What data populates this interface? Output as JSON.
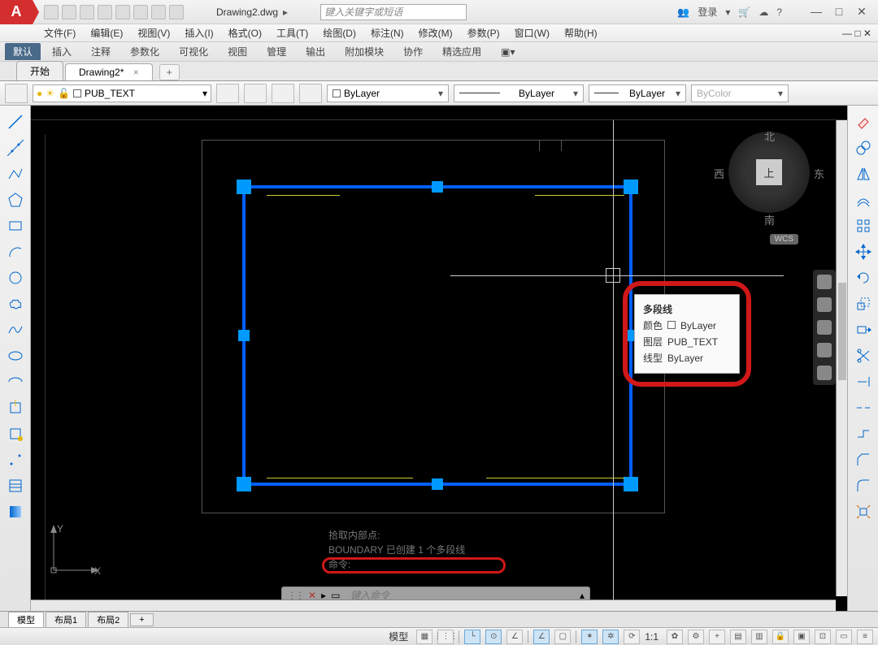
{
  "app": {
    "letter": "A",
    "doc": "Drawing2.dwg",
    "search_ph": "键入关键字或短语",
    "login": "登录"
  },
  "win": {
    "min": "—",
    "max": "□",
    "close": "✕"
  },
  "menu": [
    "文件(F)",
    "编辑(E)",
    "视图(V)",
    "插入(I)",
    "格式(O)",
    "工具(T)",
    "绘图(D)",
    "标注(N)",
    "修改(M)",
    "参数(P)",
    "窗口(W)",
    "帮助(H)"
  ],
  "ribbon": [
    "默认",
    "插入",
    "注释",
    "参数化",
    "可视化",
    "视图",
    "管理",
    "输出",
    "附加模块",
    "协作",
    "精选应用"
  ],
  "file_tabs": {
    "start": "开始",
    "current": "Drawing2*",
    "plus": "+"
  },
  "layer": {
    "name": "PUB_TEXT"
  },
  "props": {
    "color": {
      "label": "ByLayer"
    },
    "lweight": {
      "label": "ByLayer"
    },
    "ltype": {
      "label": "ByLayer"
    },
    "plot": {
      "label": "ByColor"
    }
  },
  "viewcube": {
    "n": "北",
    "s": "南",
    "e": "东",
    "w": "西",
    "top": "上",
    "wcs": "WCS"
  },
  "tooltip": {
    "title": "多段线",
    "rows": [
      {
        "k": "颜色",
        "v": "ByLayer",
        "sw": true
      },
      {
        "k": "图层",
        "v": "PUB_TEXT",
        "sw": false
      },
      {
        "k": "线型",
        "v": "ByLayer",
        "sw": false
      }
    ]
  },
  "cmd": {
    "l1": "拾取内部点:",
    "l2": "BOUNDARY 已创建 1 个多段线",
    "l3": "命令:",
    "ph": "键入命令"
  },
  "ucs": {
    "x": "X",
    "y": "Y"
  },
  "bottom_tabs": [
    "模型",
    "布局1",
    "布局2"
  ],
  "status": {
    "model": "模型",
    "scale": "1:1"
  }
}
